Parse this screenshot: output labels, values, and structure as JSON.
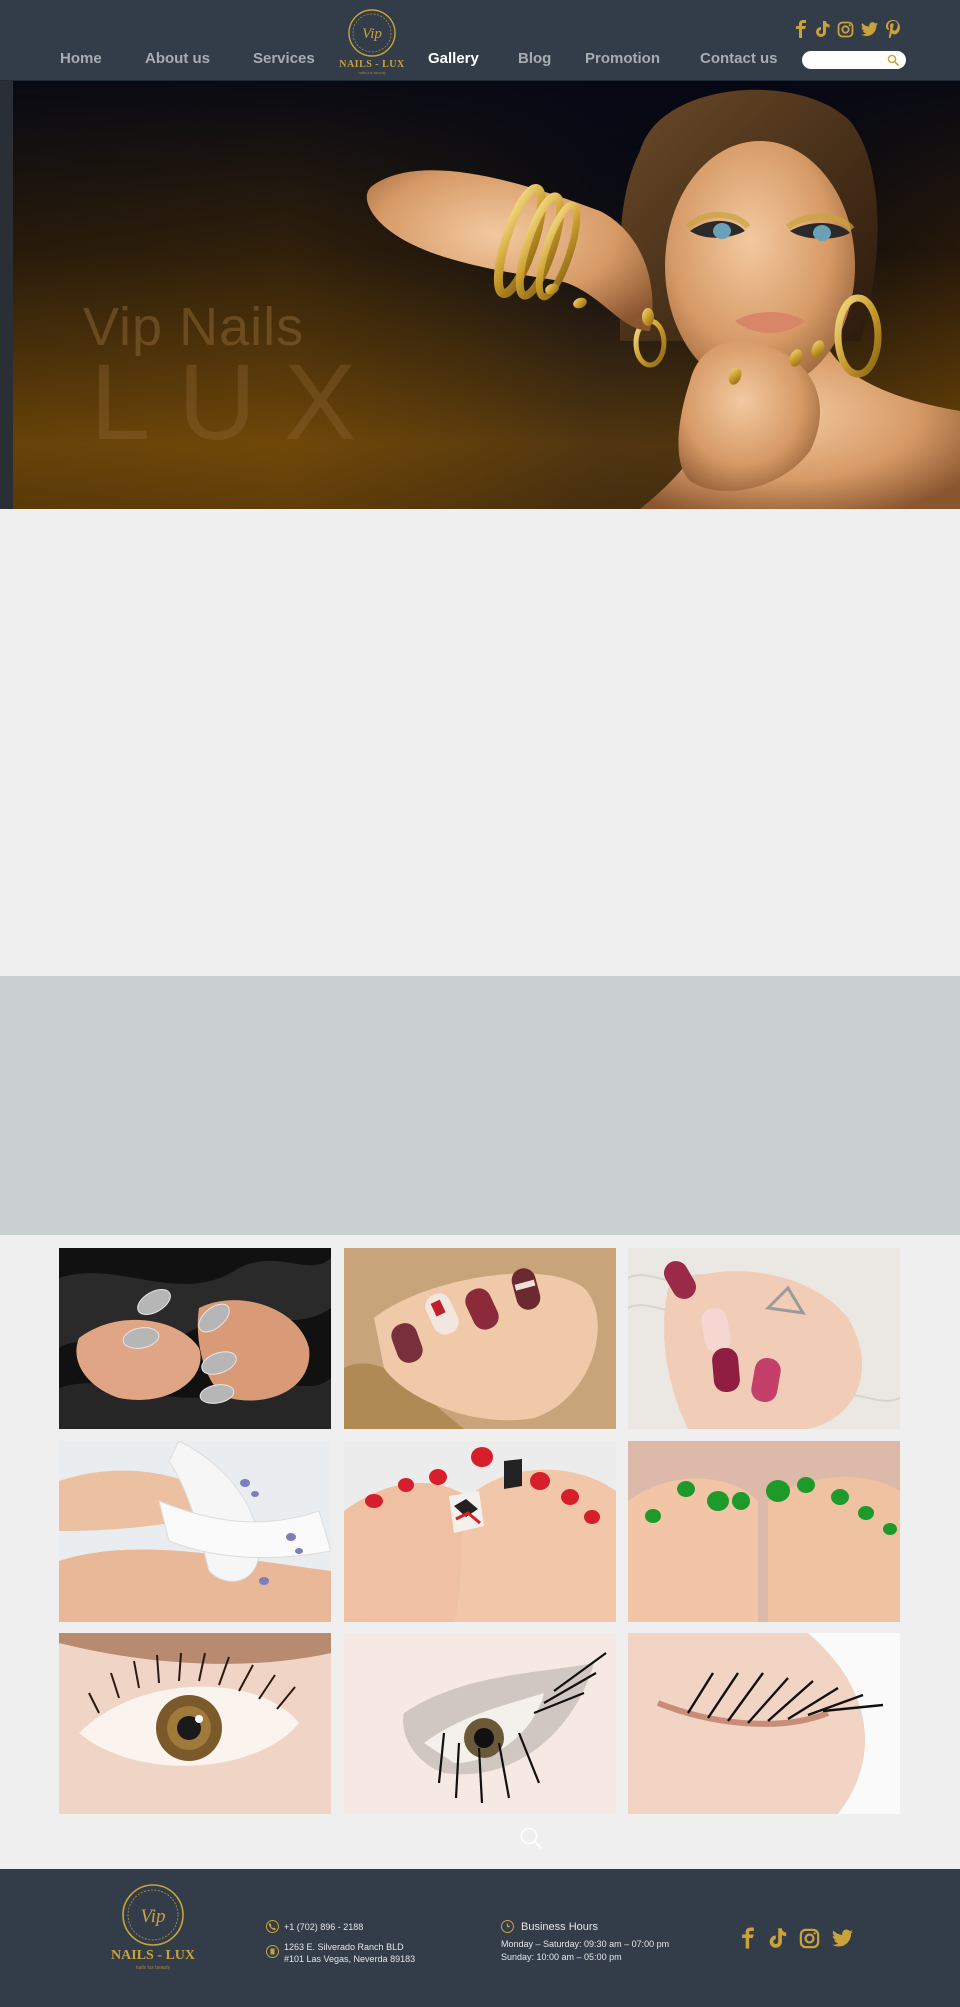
{
  "nav": {
    "items": [
      {
        "label": "Home"
      },
      {
        "label": "About us"
      },
      {
        "label": "Services"
      },
      {
        "label": "Gallery",
        "active": true
      },
      {
        "label": "Blog"
      },
      {
        "label": "Promotion"
      },
      {
        "label": "Contact us"
      }
    ],
    "logo_text": "NAILS - LUX",
    "logo_monogram": "Vip",
    "logo_tagline": "nails lux beauty",
    "search_icon": "search-icon",
    "social_icons": [
      "facebook-icon",
      "tiktok-icon",
      "instagram-icon",
      "twitter-icon",
      "pinterest-icon"
    ]
  },
  "hero": {
    "title_small": "Vip Nails",
    "title_large": "LUX"
  },
  "gallery": {
    "images": [
      {
        "name": "silver-manicure-photo"
      },
      {
        "name": "burgundy-nail-art-photo"
      },
      {
        "name": "pink-nail-art-photo"
      },
      {
        "name": "blue-pedicure-photo"
      },
      {
        "name": "red-pedicure-photo"
      },
      {
        "name": "green-pedicure-photo"
      },
      {
        "name": "eyelash-extension-photo-1"
      },
      {
        "name": "eyelash-extension-photo-2"
      },
      {
        "name": "eyelash-extension-photo-3"
      }
    ],
    "zoom_icon": "zoom-icon"
  },
  "footer": {
    "logo_text": "NAILS - LUX",
    "logo_monogram": "Vip",
    "logo_tagline": "nails lux beauty",
    "phone": "+1 (702) 896 - 2188",
    "address_line1": "1263 E. Silverado Ranch BLD",
    "address_line2": "#101 Las Vegas, Neverda 89183",
    "hours_title": "Business Hours",
    "hours_line1": "Monday – Saturday: 09:30 am – 07:00 pm",
    "hours_line2": "Sunday: 10:00 am – 05:00 pm",
    "social_icons": [
      "facebook-icon",
      "tiktok-icon",
      "instagram-icon",
      "twitter-icon"
    ]
  },
  "colors": {
    "header_bg": "#333d49",
    "accent_gold": "#c9a23c",
    "nav_text": "#a7acb3",
    "nav_active": "#ffffff",
    "grey_band": "#cacfcf",
    "page_bg": "#efefef"
  }
}
